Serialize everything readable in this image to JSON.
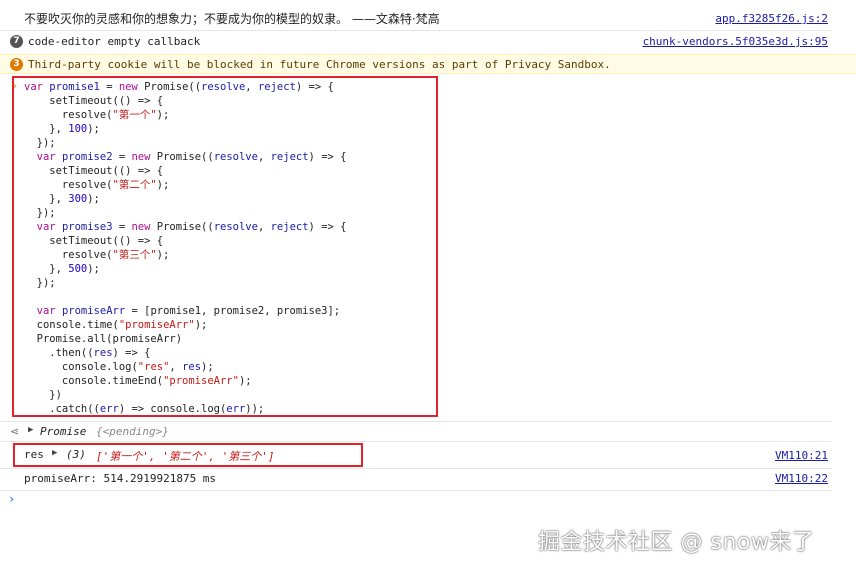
{
  "messages": {
    "quote": {
      "text": "不要吹灭你的灵感和你的想象力；不要成为你的模型的奴隶。 ——文森特·梵高",
      "source": "app.f3285f26.js:2"
    },
    "callback": {
      "count": "7",
      "text": "code-editor empty callback",
      "source": "chunk-vendors.5f035e3d.js:95"
    },
    "warning": {
      "count": "3",
      "text": "Third-party cookie will be blocked in future Chrome versions as part of Privacy Sandbox."
    }
  },
  "code_lines": [
    "var promise1 = new Promise((resolve, reject) => {",
    "    setTimeout(() => {",
    "      resolve(\"第一个\");",
    "    }, 100);",
    "  });",
    "  var promise2 = new Promise((resolve, reject) => {",
    "    setTimeout(() => {",
    "      resolve(\"第二个\");",
    "    }, 300);",
    "  });",
    "  var promise3 = new Promise((resolve, reject) => {",
    "    setTimeout(() => {",
    "      resolve(\"第三个\");",
    "    }, 500);",
    "  });",
    "",
    "  var promiseArr = [promise1, promise2, promise3];",
    "  console.time(\"promiseArr\");",
    "  Promise.all(promiseArr)",
    "    .then((res) => {",
    "      console.log(\"res\", res);",
    "      console.timeEnd(\"promiseArr\");",
    "    })",
    "    .catch((err) => console.log(err));"
  ],
  "result": {
    "label": "Promise",
    "state": "{<pending>}"
  },
  "log_res": {
    "key": "res",
    "count": "(3)",
    "values": "['第一个', '第二个', '第三个']",
    "source": "VM110:21"
  },
  "log_time": {
    "text": "promiseArr: 514.2919921875 ms",
    "source": "VM110:22"
  },
  "watermark": "掘金技术社区 @ snow来了",
  "colors": {
    "warning_bg": "#fffbe5",
    "highlight": "#e0222a",
    "link": "#1a1aa6",
    "badge_warn": "#e07b00",
    "badge_info": "#555555"
  }
}
